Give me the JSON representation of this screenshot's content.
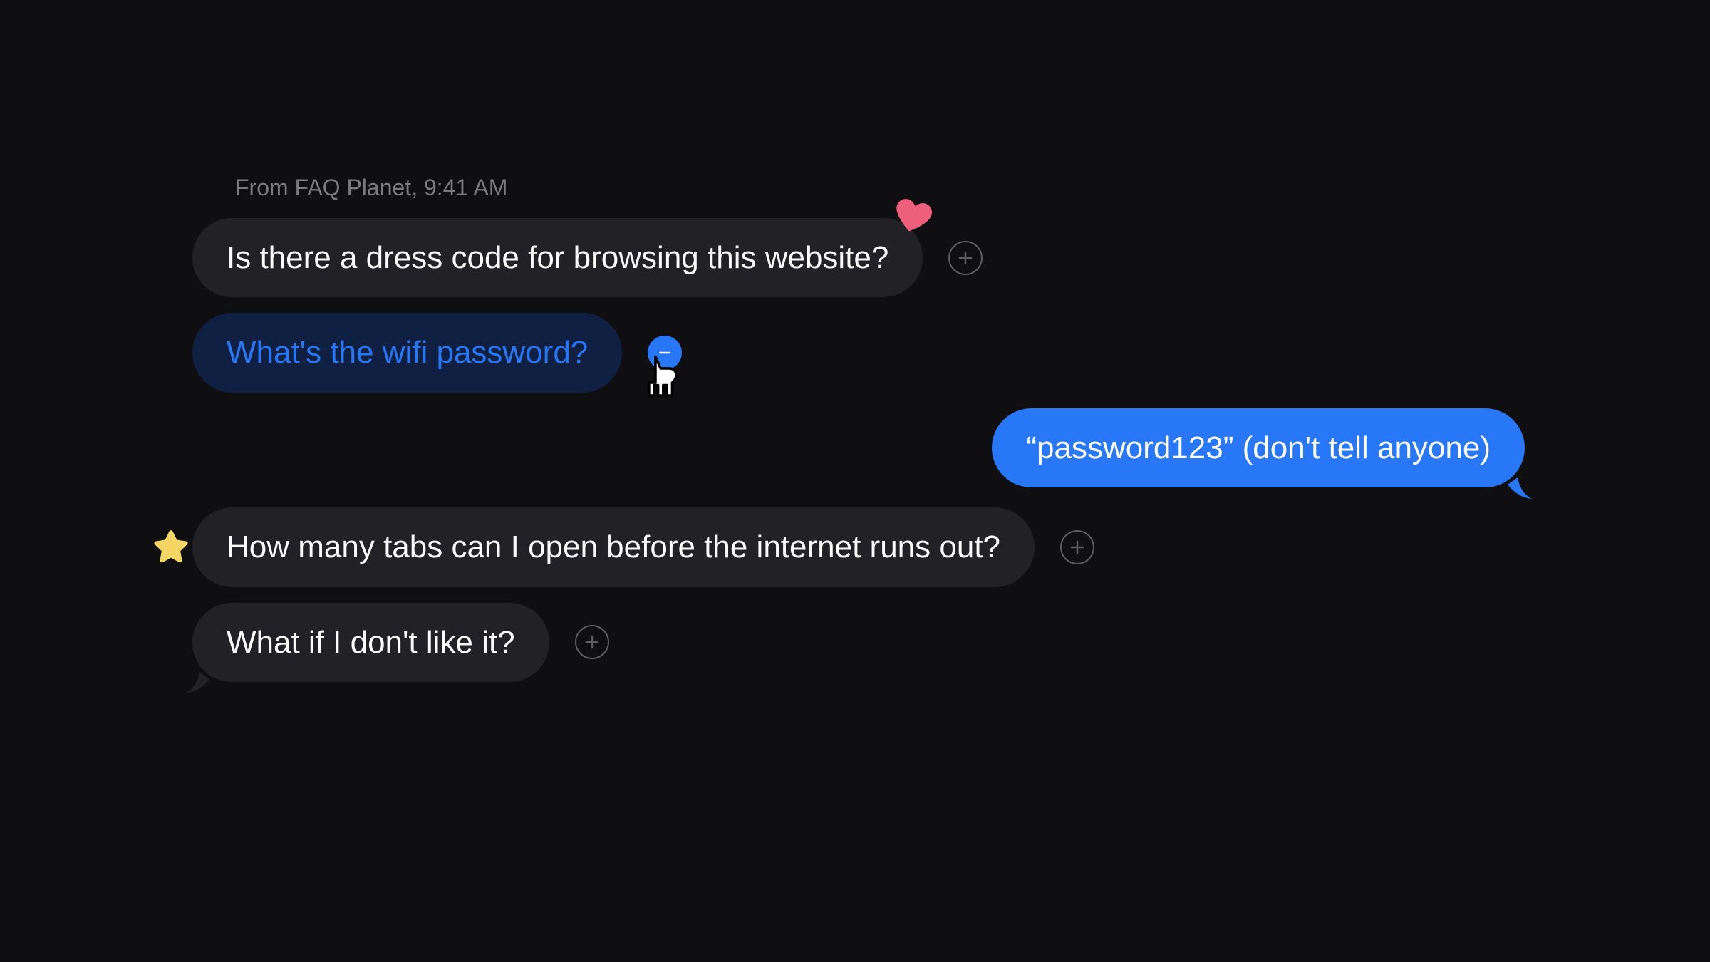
{
  "header": {
    "from_line": "From FAQ Planet, 9:41 AM"
  },
  "messages": [
    {
      "direction": "incoming",
      "text": "Is there a dress code for browsing this website?",
      "action": "plus",
      "reaction": "heart"
    },
    {
      "direction": "incoming",
      "text": "What's the wifi password?",
      "action": "minus",
      "selected": true
    },
    {
      "direction": "outgoing",
      "text": "“password123” (don't tell anyone)"
    },
    {
      "direction": "incoming",
      "text": "How many tabs can I open before the internet runs out?",
      "action": "plus",
      "reaction": "star",
      "wide": true
    },
    {
      "direction": "incoming",
      "text": "What if I don't like it?",
      "action": "plus",
      "tail": true
    }
  ],
  "colors": {
    "background": "#0f0f11",
    "bubble_incoming": "#222226",
    "bubble_incoming_selected_bg": "#102042",
    "bubble_incoming_selected_fg": "#2877f6",
    "bubble_outgoing": "#2877f6",
    "text_primary": "#fbfbfc",
    "text_secondary": "#7a7a7e",
    "heart": "#ed5f7a",
    "star": "#f5d665"
  }
}
